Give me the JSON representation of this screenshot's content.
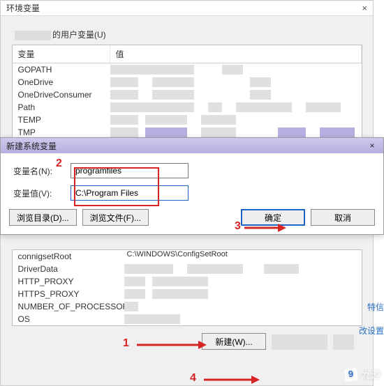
{
  "bg_window": {
    "title": "环境变量",
    "user_vars_label_suffix": "的用户变量(U)",
    "col_var": "变量",
    "col_val": "值",
    "user_rows": [
      "GOPATH",
      "OneDrive",
      "OneDriveConsumer",
      "Path",
      "TEMP",
      "TMP"
    ],
    "sys_rows": [
      "connigsetRoot",
      "DriverData",
      "HTTP_PROXY",
      "HTTPS_PROXY",
      "NUMBER_OF_PROCESSORS",
      "OS"
    ],
    "sys_row0_val": "C:\\WINDOWS\\ConfigSetRoot",
    "new_btn": "新建(W)..."
  },
  "modal": {
    "title": "新建系统变量",
    "name_label": "变量名(N):",
    "value_label": "变量值(V):",
    "name_value": "programfiles",
    "path_value": "C:\\Program Files",
    "browse_dir": "浏览目录(D)...",
    "browse_file": "浏览文件(F)...",
    "ok": "确定",
    "cancel": "取消"
  },
  "side": {
    "text1": "特信",
    "text2": "改设置"
  },
  "annot": {
    "n1": "1",
    "n2": "2",
    "n3": "3",
    "n4": "4"
  },
  "watermark": "九游"
}
